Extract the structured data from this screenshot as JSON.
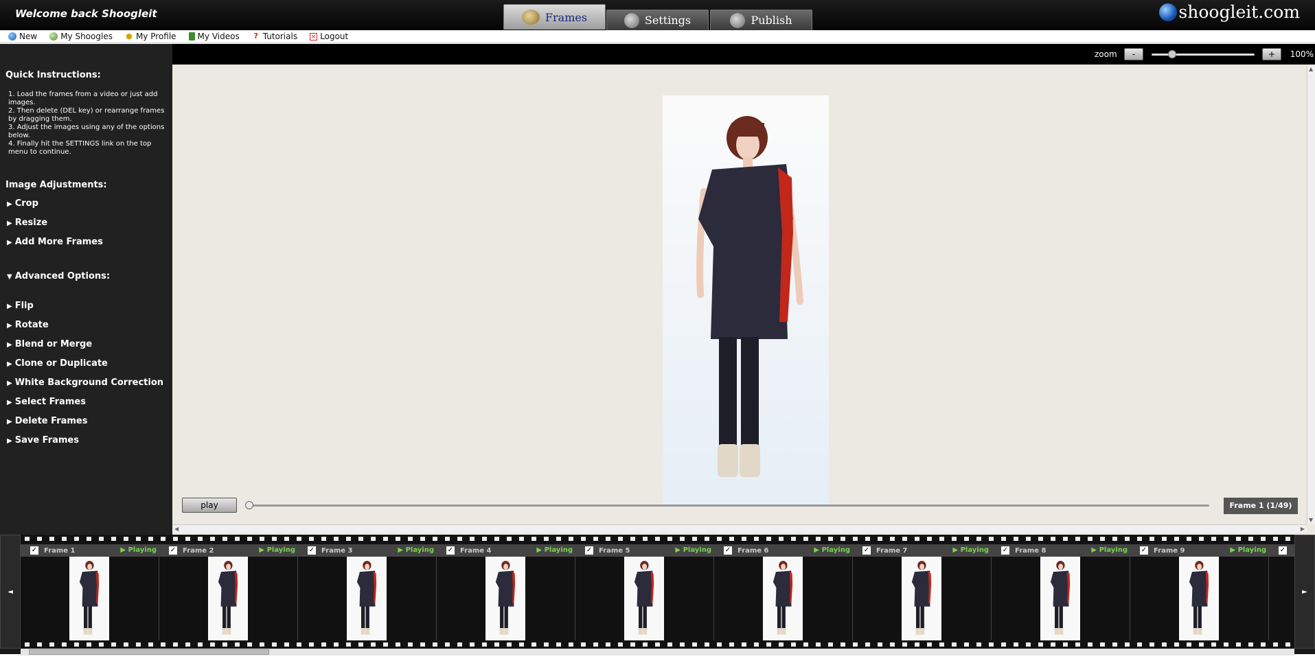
{
  "header": {
    "welcome": "Welcome back Shoogleit",
    "tabs": [
      {
        "label": "Frames",
        "active": true
      },
      {
        "label": "Settings",
        "active": false
      },
      {
        "label": "Publish",
        "active": false
      }
    ],
    "logo": "shoogleit.com"
  },
  "menu": {
    "items": [
      {
        "label": "New",
        "icon": "new-icon"
      },
      {
        "label": "My Shoogles",
        "icon": "shoogles-icon"
      },
      {
        "label": "My Profile",
        "icon": "profile-icon"
      },
      {
        "label": "My Videos",
        "icon": "videos-icon"
      },
      {
        "label": "Tutorials",
        "icon": "help-icon"
      },
      {
        "label": "Logout",
        "icon": "logout-icon"
      }
    ]
  },
  "sidebar": {
    "quick_title": "Quick Instructions:",
    "instructions": [
      "1. Load the frames from a video or just add images.",
      "2. Then delete (DEL key) or rearrange frames by dragging them.",
      "3. Adjust the images using any of the options below.",
      "4. Finally hit the SETTINGS link on the top menu to continue."
    ],
    "adjust_title": "Image Adjustments:",
    "adjust_items": [
      "Crop",
      "Resize",
      "Add More Frames"
    ],
    "advanced_title": "Advanced Options:",
    "advanced_items": [
      "Flip",
      "Rotate",
      "Blend or Merge",
      "Clone or Duplicate",
      "White Background Correction",
      "Select Frames",
      "Delete Frames",
      "Save Frames"
    ]
  },
  "toolbar": {
    "zoom_label": "zoom",
    "zoom_out": "-",
    "zoom_in": "+",
    "zoom_value": "100%",
    "zoom_level": 0.2
  },
  "player": {
    "play_label": "play",
    "frame_counter": "Frame 1 (1/49)",
    "position": 0
  },
  "filmstrip": {
    "frames": [
      {
        "label": "Frame 1",
        "status": "Playing"
      },
      {
        "label": "Frame 2",
        "status": "Playing"
      },
      {
        "label": "Frame 3",
        "status": "Playing"
      },
      {
        "label": "Frame 4",
        "status": "Playing"
      },
      {
        "label": "Frame 5",
        "status": "Playing"
      },
      {
        "label": "Frame 6",
        "status": "Playing"
      },
      {
        "label": "Frame 7",
        "status": "Playing"
      },
      {
        "label": "Frame 8",
        "status": "Playing"
      },
      {
        "label": "Frame 9",
        "status": "Playing"
      }
    ],
    "prev": "◄",
    "next": "►",
    "checkmark": "✓"
  }
}
